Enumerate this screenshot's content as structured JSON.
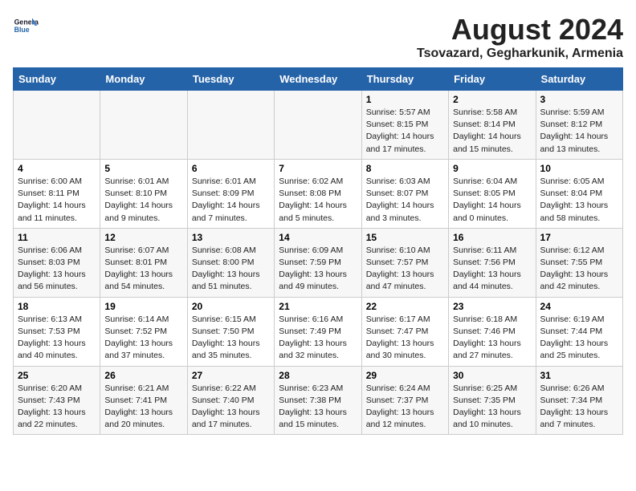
{
  "header": {
    "logo_general": "General",
    "logo_blue": "Blue",
    "month_year": "August 2024",
    "location": "Tsovazard, Gegharkunik, Armenia"
  },
  "weekdays": [
    "Sunday",
    "Monday",
    "Tuesday",
    "Wednesday",
    "Thursday",
    "Friday",
    "Saturday"
  ],
  "weeks": [
    [
      {
        "day": "",
        "info": ""
      },
      {
        "day": "",
        "info": ""
      },
      {
        "day": "",
        "info": ""
      },
      {
        "day": "",
        "info": ""
      },
      {
        "day": "1",
        "info": "Sunrise: 5:57 AM\nSunset: 8:15 PM\nDaylight: 14 hours\nand 17 minutes."
      },
      {
        "day": "2",
        "info": "Sunrise: 5:58 AM\nSunset: 8:14 PM\nDaylight: 14 hours\nand 15 minutes."
      },
      {
        "day": "3",
        "info": "Sunrise: 5:59 AM\nSunset: 8:12 PM\nDaylight: 14 hours\nand 13 minutes."
      }
    ],
    [
      {
        "day": "4",
        "info": "Sunrise: 6:00 AM\nSunset: 8:11 PM\nDaylight: 14 hours\nand 11 minutes."
      },
      {
        "day": "5",
        "info": "Sunrise: 6:01 AM\nSunset: 8:10 PM\nDaylight: 14 hours\nand 9 minutes."
      },
      {
        "day": "6",
        "info": "Sunrise: 6:01 AM\nSunset: 8:09 PM\nDaylight: 14 hours\nand 7 minutes."
      },
      {
        "day": "7",
        "info": "Sunrise: 6:02 AM\nSunset: 8:08 PM\nDaylight: 14 hours\nand 5 minutes."
      },
      {
        "day": "8",
        "info": "Sunrise: 6:03 AM\nSunset: 8:07 PM\nDaylight: 14 hours\nand 3 minutes."
      },
      {
        "day": "9",
        "info": "Sunrise: 6:04 AM\nSunset: 8:05 PM\nDaylight: 14 hours\nand 0 minutes."
      },
      {
        "day": "10",
        "info": "Sunrise: 6:05 AM\nSunset: 8:04 PM\nDaylight: 13 hours\nand 58 minutes."
      }
    ],
    [
      {
        "day": "11",
        "info": "Sunrise: 6:06 AM\nSunset: 8:03 PM\nDaylight: 13 hours\nand 56 minutes."
      },
      {
        "day": "12",
        "info": "Sunrise: 6:07 AM\nSunset: 8:01 PM\nDaylight: 13 hours\nand 54 minutes."
      },
      {
        "day": "13",
        "info": "Sunrise: 6:08 AM\nSunset: 8:00 PM\nDaylight: 13 hours\nand 51 minutes."
      },
      {
        "day": "14",
        "info": "Sunrise: 6:09 AM\nSunset: 7:59 PM\nDaylight: 13 hours\nand 49 minutes."
      },
      {
        "day": "15",
        "info": "Sunrise: 6:10 AM\nSunset: 7:57 PM\nDaylight: 13 hours\nand 47 minutes."
      },
      {
        "day": "16",
        "info": "Sunrise: 6:11 AM\nSunset: 7:56 PM\nDaylight: 13 hours\nand 44 minutes."
      },
      {
        "day": "17",
        "info": "Sunrise: 6:12 AM\nSunset: 7:55 PM\nDaylight: 13 hours\nand 42 minutes."
      }
    ],
    [
      {
        "day": "18",
        "info": "Sunrise: 6:13 AM\nSunset: 7:53 PM\nDaylight: 13 hours\nand 40 minutes."
      },
      {
        "day": "19",
        "info": "Sunrise: 6:14 AM\nSunset: 7:52 PM\nDaylight: 13 hours\nand 37 minutes."
      },
      {
        "day": "20",
        "info": "Sunrise: 6:15 AM\nSunset: 7:50 PM\nDaylight: 13 hours\nand 35 minutes."
      },
      {
        "day": "21",
        "info": "Sunrise: 6:16 AM\nSunset: 7:49 PM\nDaylight: 13 hours\nand 32 minutes."
      },
      {
        "day": "22",
        "info": "Sunrise: 6:17 AM\nSunset: 7:47 PM\nDaylight: 13 hours\nand 30 minutes."
      },
      {
        "day": "23",
        "info": "Sunrise: 6:18 AM\nSunset: 7:46 PM\nDaylight: 13 hours\nand 27 minutes."
      },
      {
        "day": "24",
        "info": "Sunrise: 6:19 AM\nSunset: 7:44 PM\nDaylight: 13 hours\nand 25 minutes."
      }
    ],
    [
      {
        "day": "25",
        "info": "Sunrise: 6:20 AM\nSunset: 7:43 PM\nDaylight: 13 hours\nand 22 minutes."
      },
      {
        "day": "26",
        "info": "Sunrise: 6:21 AM\nSunset: 7:41 PM\nDaylight: 13 hours\nand 20 minutes."
      },
      {
        "day": "27",
        "info": "Sunrise: 6:22 AM\nSunset: 7:40 PM\nDaylight: 13 hours\nand 17 minutes."
      },
      {
        "day": "28",
        "info": "Sunrise: 6:23 AM\nSunset: 7:38 PM\nDaylight: 13 hours\nand 15 minutes."
      },
      {
        "day": "29",
        "info": "Sunrise: 6:24 AM\nSunset: 7:37 PM\nDaylight: 13 hours\nand 12 minutes."
      },
      {
        "day": "30",
        "info": "Sunrise: 6:25 AM\nSunset: 7:35 PM\nDaylight: 13 hours\nand 10 minutes."
      },
      {
        "day": "31",
        "info": "Sunrise: 6:26 AM\nSunset: 7:34 PM\nDaylight: 13 hours\nand 7 minutes."
      }
    ]
  ]
}
